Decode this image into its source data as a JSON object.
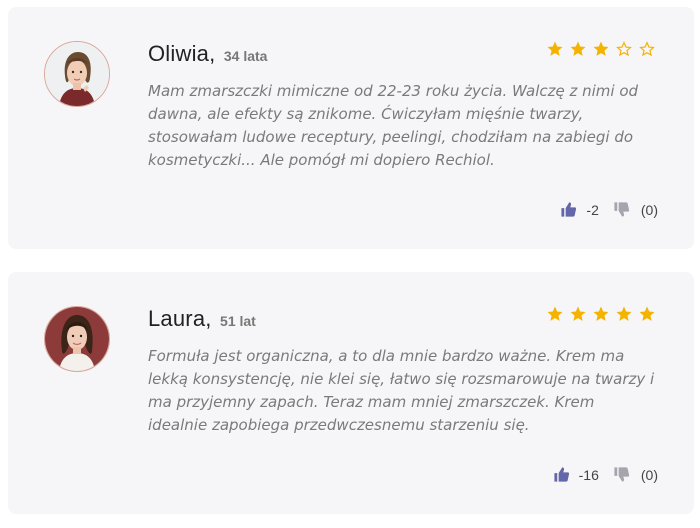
{
  "colors": {
    "card_bg": "#f6f6f8",
    "star_filled": "#f5b301",
    "thumb_up": "#6366a8",
    "thumb_down": "#a4a5ad",
    "text": "#7a7a7a"
  },
  "reviews": [
    {
      "name": "Oliwia,",
      "age": "34 lata",
      "rating": 3,
      "max_rating": 5,
      "text": "Mam zmarszczki mimiczne od 22-23 roku życia. Walczę z nimi od dawna, ale efekty są znikome. Ćwiczyłam mięśnie twarzy, stosowałam ludowe receptury, peelingi, chodziłam na zabiegi do kosmetyczki... Ale pomógł mi dopiero Rechiol.",
      "up_count": "-2",
      "down_count": "(0)",
      "avatar_icon": "woman-portrait-icon"
    },
    {
      "name": "Laura,",
      "age": "51 lat",
      "rating": 5,
      "max_rating": 5,
      "text": "Formuła jest organiczna, a to dla mnie bardzo ważne. Krem ma lekką konsystencję, nie klei się, łatwo się rozsmarowuje na twarzy i ma przyjemny zapach. Teraz mam mniej zmarszczek. Krem idealnie zapobiega przedwczesnemu starzeniu się.",
      "up_count": "-16",
      "down_count": "(0)",
      "avatar_icon": "woman-portrait-icon"
    }
  ]
}
